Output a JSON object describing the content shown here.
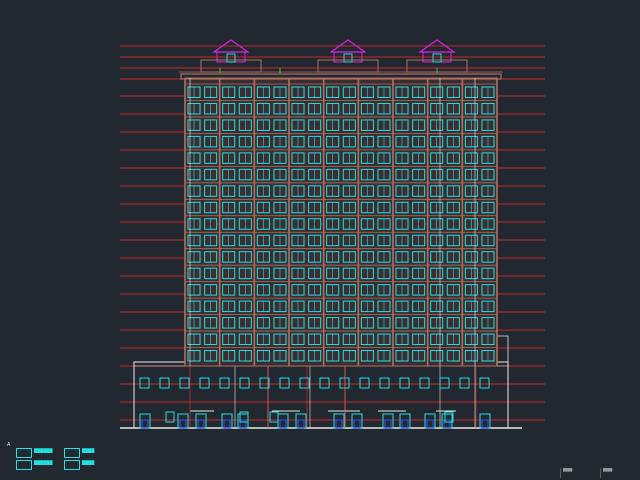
{
  "drawing": {
    "legend": [
      {
        "label": "██████",
        "swatch": "#22e0e0"
      },
      {
        "label": "██████",
        "swatch": "#22e0e0"
      },
      {
        "label": "████",
        "swatch": "#22e0e0"
      },
      {
        "label": "████",
        "swatch": "#22e0e0"
      }
    ],
    "marker": "A",
    "titleblock": [
      "████",
      "████"
    ],
    "colors": {
      "background": "#212830",
      "level_lines": "#ff2a2a",
      "facade": "#b07060",
      "windows": "#22e0e0",
      "roof_pavilion": "#e020e0",
      "outline": "#e8e8e8",
      "accent_green": "#22e022",
      "doors": "#3050ff"
    },
    "floors": 15,
    "window_columns": 9
  }
}
